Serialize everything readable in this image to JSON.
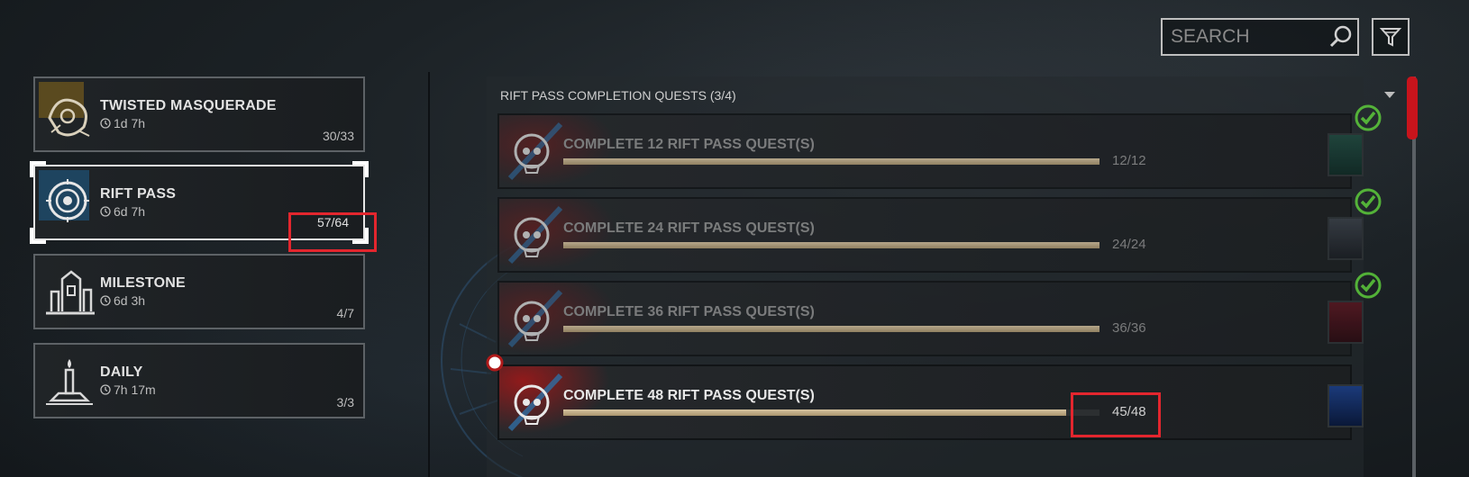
{
  "search": {
    "placeholder": "SEARCH"
  },
  "categories": [
    {
      "title": "TWISTED MASQUERADE",
      "timer": "1d 7h",
      "count": "30/33"
    },
    {
      "title": "RIFT PASS",
      "timer": "6d 7h",
      "count": "57/64"
    },
    {
      "title": "MILESTONE",
      "timer": "6d 3h",
      "count": "4/7"
    },
    {
      "title": "DAILY",
      "timer": "7h 17m",
      "count": "3/3"
    }
  ],
  "quest_group": {
    "title": "RIFT PASS COMPLETION QUESTS",
    "count": "(3/4)"
  },
  "quests": [
    {
      "name": "COMPLETE 12 RIFT PASS QUEST(S)",
      "progress_text": "12/12",
      "progress": 1.0,
      "completed": true
    },
    {
      "name": "COMPLETE 24 RIFT PASS QUEST(S)",
      "progress_text": "24/24",
      "progress": 1.0,
      "completed": true
    },
    {
      "name": "COMPLETE 36 RIFT PASS QUEST(S)",
      "progress_text": "36/36",
      "progress": 1.0,
      "completed": true
    },
    {
      "name": "COMPLETE 48 RIFT PASS QUEST(S)",
      "progress_text": "45/48",
      "progress": 0.9375,
      "completed": false
    }
  ],
  "colors": {
    "highlight": "#e3262e",
    "accent_red": "#c8141c",
    "check_green": "#5fd13c",
    "bar": "#c9b48c"
  },
  "icons": [
    "search-icon",
    "filter-icon",
    "clock-icon",
    "checkmark-icon",
    "skull-emblem-icon",
    "chevron-down-icon"
  ]
}
